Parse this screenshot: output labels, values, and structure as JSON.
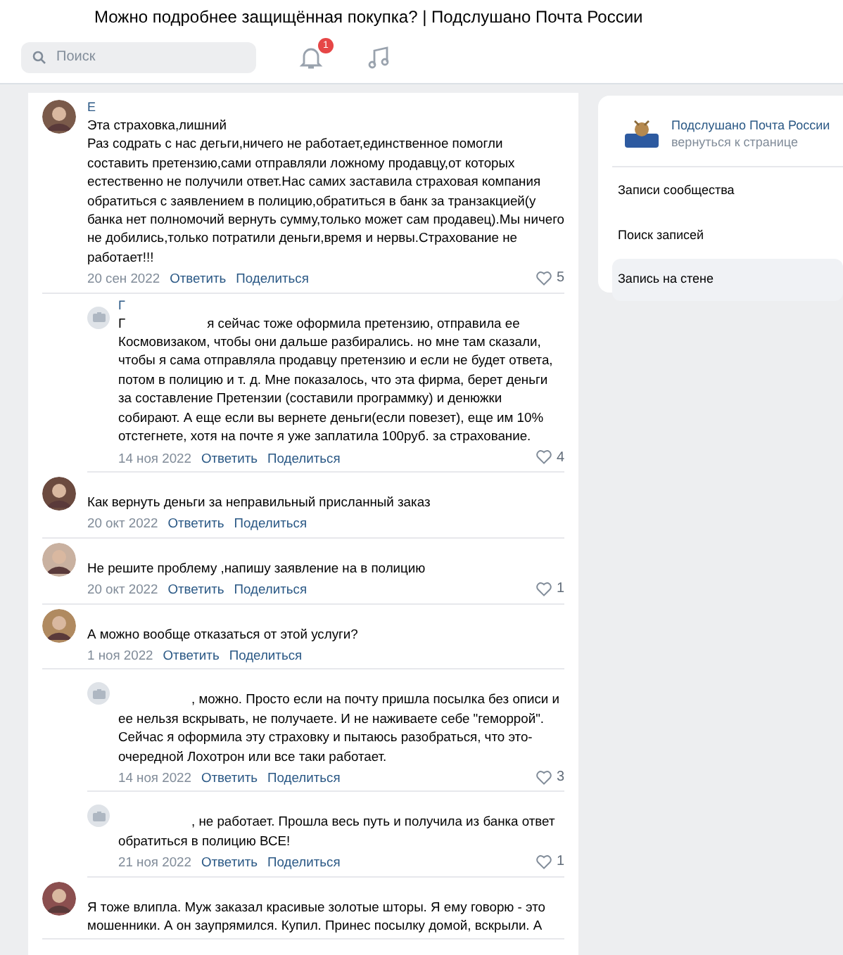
{
  "window": {
    "title": "Можно подробнее защищённая покупка? | Подслушано Почта России"
  },
  "header": {
    "search": {
      "placeholder": "Поиск"
    },
    "notifications_badge": "1"
  },
  "comments": [
    {
      "kind": "top",
      "author": "Е",
      "title": "Эта страховка,лишний",
      "text": "Раз содрать с нас дегьги,ничего не работает,единственное помогли составить претензию,сами отправляли ложному продавцу,от которых естественно не получили ответ.Нас самих заставила страховая компания обратиться с заявлением в полицию,обратиться в банк за транзакцией(у банка нет полномочий вернуть сумму,только может сам продавец).Мы ничего не добились,только потратили деньги,время и нервы.Страхование не работает!!!",
      "date": "20 сен 2022",
      "reply": "Ответить",
      "share": "Поделиться",
      "likes": "5"
    },
    {
      "kind": "reply",
      "author": "Г",
      "mention": "Г",
      "text": "я сейчас тоже оформила претензию, отправила ее Космовизаком, чтобы они дальше разбирались. но мне там сказали, чтобы я сама отправляла продавцу претензию и если не будет ответа, потом в полицию и т. д. Мне показалось, что эта фирма, берет деньги за составление Претензии (составили программку) и денюжки собирают. А еще если вы вернете деньги(если повезет), еще им 10% отстегнете, хотя на почте я уже заплатила 100руб. за страхование.",
      "date": "14 ноя 2022",
      "reply": "Ответить",
      "share": "Поделиться",
      "likes": "4"
    },
    {
      "kind": "top",
      "text": "Как вернуть деньги за неправильный присланный заказ",
      "date": "20 окт 2022",
      "reply": "Ответить",
      "share": "Поделиться"
    },
    {
      "kind": "top",
      "text": "Не решите проблему ,напишу заявление на в полицию",
      "date": "20 окт 2022",
      "reply": "Ответить",
      "share": "Поделиться",
      "likes": "1"
    },
    {
      "kind": "top",
      "text": "А можно вообще отказаться от этой услуги?",
      "date": "1 ноя 2022",
      "reply": "Ответить",
      "share": "Поделиться"
    },
    {
      "kind": "reply",
      "text": ", можно. Просто если на почту пришла посылка без описи и ее нельзя вскрывать, не получаете. И не наживаете себе \"геморрой\". Сейчас я оформила эту страховку и пытаюсь разобраться, что это-очередной Лохотрон или все таки работает.",
      "date": "14 ноя 2022",
      "reply": "Ответить",
      "share": "Поделиться",
      "likes": "3"
    },
    {
      "kind": "reply",
      "text": ", не работает. Прошла весь путь и получила из банка ответ обратиться в полицию ВСЕ!",
      "date": "21 ноя 2022",
      "reply": "Ответить",
      "share": "Поделиться",
      "likes": "1"
    },
    {
      "kind": "top",
      "text": "Я тоже влипла. Муж заказал красивые золотые шторы. Я ему говорю - это мошенники. А он заупрямился. Купил. Принес посылку домой, вскрыли. А"
    }
  ],
  "sidebar": {
    "group_name": "Подслушано Почта России",
    "back_link": "вернуться к странице",
    "items": [
      {
        "label": "Записи сообщества",
        "selected": false
      },
      {
        "label": "Поиск записей",
        "selected": false
      },
      {
        "label": "Запись на стене",
        "selected": true
      }
    ]
  }
}
